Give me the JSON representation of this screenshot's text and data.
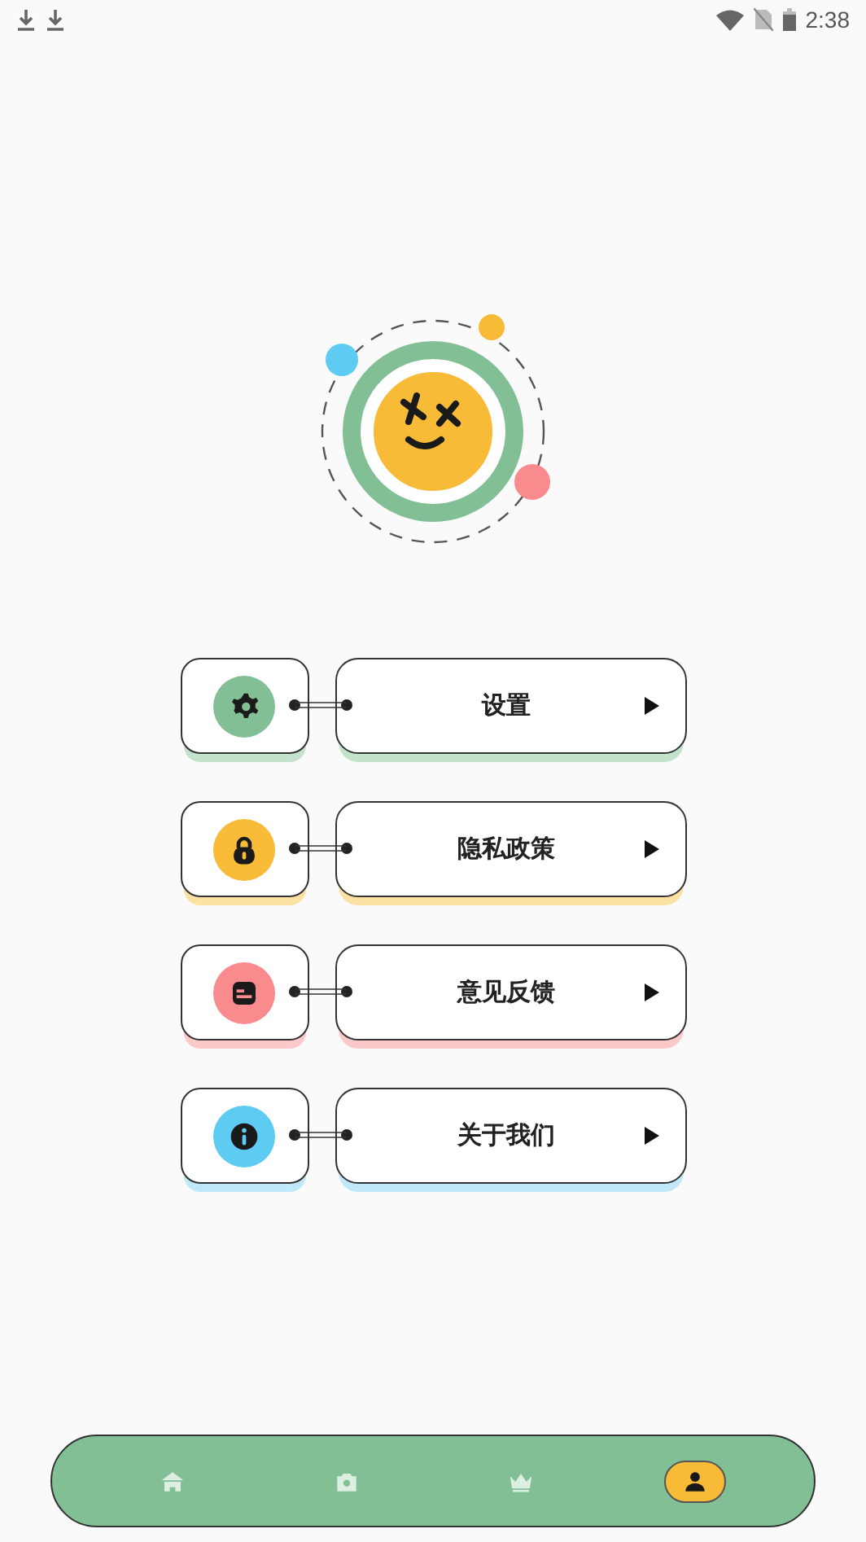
{
  "status_bar": {
    "time": "2:38"
  },
  "menu": [
    {
      "label": "设置",
      "kind": "gear",
      "color": "#82bf95"
    },
    {
      "label": "隐私政策",
      "kind": "lock",
      "color": "#f8bb38"
    },
    {
      "label": "意见反馈",
      "kind": "chat",
      "color": "#f98a8e"
    },
    {
      "label": "关于我们",
      "kind": "info",
      "color": "#5ecbf3"
    }
  ],
  "bottom_nav": [
    {
      "kind": "home",
      "selected": false
    },
    {
      "kind": "camera",
      "selected": false
    },
    {
      "kind": "crown",
      "selected": false
    },
    {
      "kind": "person",
      "selected": true
    }
  ]
}
